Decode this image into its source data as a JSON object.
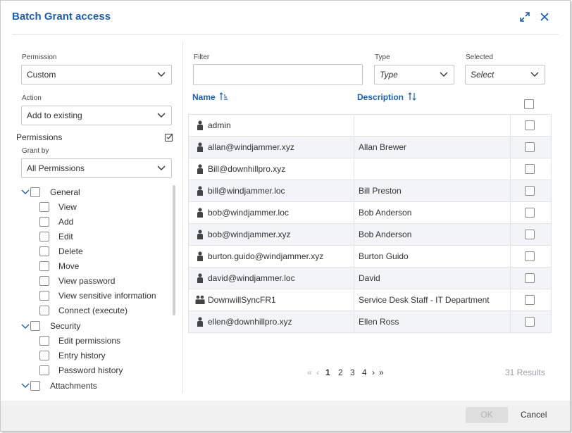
{
  "dialog": {
    "title": "Batch Grant access"
  },
  "left": {
    "permission_label": "Permission",
    "permission_value": "Custom",
    "action_label": "Action",
    "action_value": "Add to existing",
    "permissions_heading": "Permissions",
    "grant_by_label": "Grant by",
    "grant_by_value": "All Permissions",
    "groups": [
      {
        "label": "General",
        "items": [
          "View",
          "Add",
          "Edit",
          "Delete",
          "Move",
          "View password",
          "View sensitive information",
          "Connect (execute)"
        ]
      },
      {
        "label": "Security",
        "items": [
          "Edit permissions",
          "Entry history",
          "Password history"
        ]
      },
      {
        "label": "Attachments",
        "items": []
      }
    ]
  },
  "filters": {
    "filter_label": "Filter",
    "filter_value": "",
    "type_label": "Type",
    "type_placeholder": "Type",
    "selected_label": "Selected",
    "selected_placeholder": "Select"
  },
  "table": {
    "headers": {
      "name": "Name",
      "description": "Description"
    },
    "rows": [
      {
        "name": "admin",
        "description": "",
        "icon": "user-icon"
      },
      {
        "name": "allan@windjammer.xyz",
        "description": "Allan Brewer",
        "icon": "user-icon"
      },
      {
        "name": "Bill@downhillpro.xyz",
        "description": "",
        "icon": "user-icon"
      },
      {
        "name": "bill@windjammer.loc",
        "description": "Bill Preston",
        "icon": "user-icon"
      },
      {
        "name": "bob@windjammer.loc",
        "description": "Bob Anderson",
        "icon": "user-icon"
      },
      {
        "name": "bob@windjammer.xyz",
        "description": "Bob Anderson",
        "icon": "user-icon"
      },
      {
        "name": "burton.guido@windjammer.xyz",
        "description": "Burton Guido",
        "icon": "user-icon"
      },
      {
        "name": "david@windjammer.loc",
        "description": "David",
        "icon": "user-icon"
      },
      {
        "name": "DownwillSyncFR1",
        "description": "Service Desk Staff - IT Department",
        "icon": "group-icon"
      },
      {
        "name": "ellen@downhillpro.xyz",
        "description": "Ellen Ross",
        "icon": "user-icon"
      }
    ]
  },
  "pagination": {
    "first": "«",
    "prev": "‹",
    "pages": [
      "1",
      "2",
      "3",
      "4"
    ],
    "next": "›",
    "last": "»",
    "results": "31 Results"
  },
  "footer": {
    "ok_label": "OK",
    "cancel_label": "Cancel"
  },
  "colors": {
    "accent": "#1f5fa8",
    "row_alt": "#f2f4f7",
    "footer_bg": "#f1f1f1"
  }
}
